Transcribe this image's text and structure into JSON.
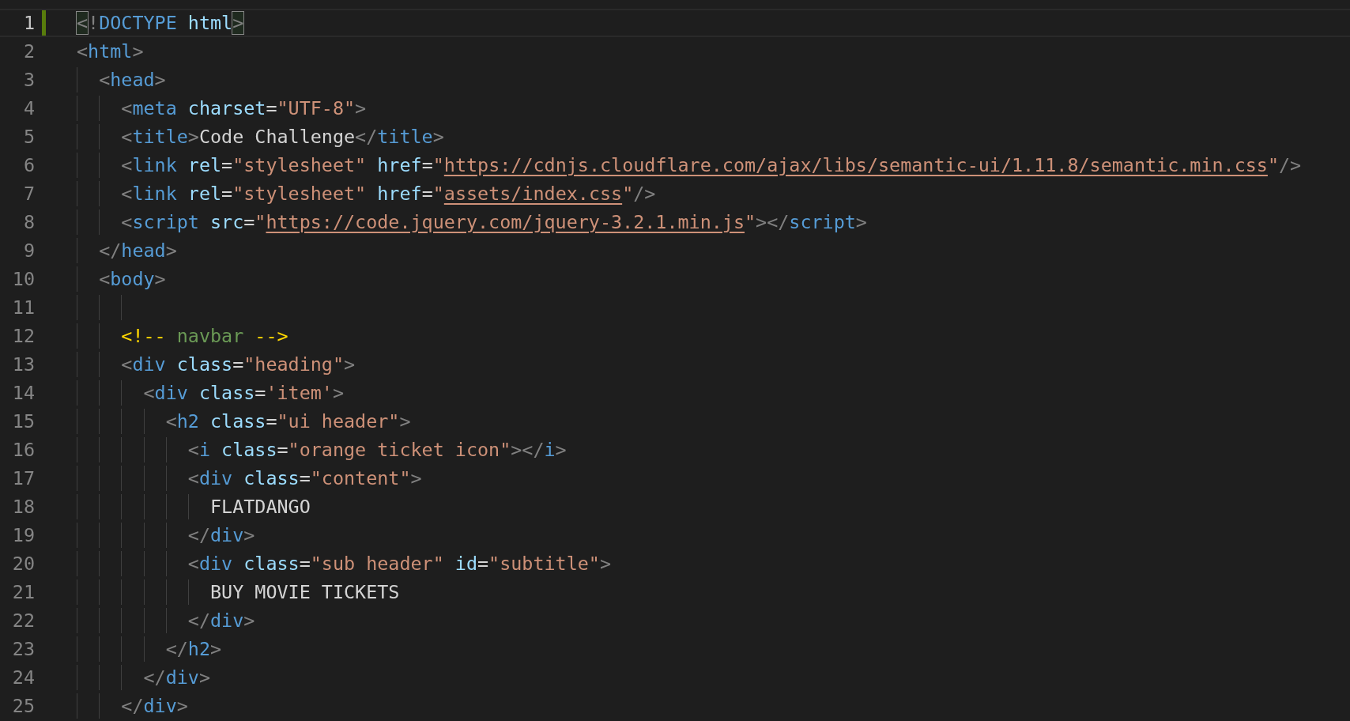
{
  "editor": {
    "lines": [
      {
        "number": "1",
        "current": true,
        "modified": true,
        "tokens": [
          {
            "kind": "match",
            "text": "<"
          },
          {
            "kind": "punct",
            "text": "!"
          },
          {
            "kind": "tag",
            "text": "DOCTYPE"
          },
          {
            "kind": "attr",
            "text": " html"
          },
          {
            "kind": "match",
            "text": ">"
          }
        ]
      },
      {
        "number": "2",
        "current": false,
        "modified": false,
        "tokens": [
          {
            "kind": "punct",
            "text": "<"
          },
          {
            "kind": "tag",
            "text": "html"
          },
          {
            "kind": "punct",
            "text": ">"
          }
        ]
      },
      {
        "number": "3",
        "current": false,
        "modified": false,
        "tokens": [
          {
            "kind": "punct",
            "text": "  <"
          },
          {
            "kind": "tag",
            "text": "head"
          },
          {
            "kind": "punct",
            "text": ">"
          }
        ]
      },
      {
        "number": "4",
        "current": false,
        "modified": false,
        "tokens": [
          {
            "kind": "punct",
            "text": "    <"
          },
          {
            "kind": "tag",
            "text": "meta"
          },
          {
            "kind": "attr",
            "text": " charset"
          },
          {
            "kind": "text",
            "text": "="
          },
          {
            "kind": "string",
            "text": "\"UTF-8\""
          },
          {
            "kind": "punct",
            "text": ">"
          }
        ]
      },
      {
        "number": "5",
        "current": false,
        "modified": false,
        "tokens": [
          {
            "kind": "punct",
            "text": "    <"
          },
          {
            "kind": "tag",
            "text": "title"
          },
          {
            "kind": "punct",
            "text": ">"
          },
          {
            "kind": "text",
            "text": "Code Challenge"
          },
          {
            "kind": "punct",
            "text": "</"
          },
          {
            "kind": "tag",
            "text": "title"
          },
          {
            "kind": "punct",
            "text": ">"
          }
        ]
      },
      {
        "number": "6",
        "current": false,
        "modified": false,
        "tokens": [
          {
            "kind": "punct",
            "text": "    <"
          },
          {
            "kind": "tag",
            "text": "link"
          },
          {
            "kind": "attr",
            "text": " rel"
          },
          {
            "kind": "text",
            "text": "="
          },
          {
            "kind": "string",
            "text": "\"stylesheet\""
          },
          {
            "kind": "attr",
            "text": " href"
          },
          {
            "kind": "text",
            "text": "="
          },
          {
            "kind": "string",
            "text": "\""
          },
          {
            "kind": "link",
            "text": "https://cdnjs.cloudflare.com/ajax/libs/semantic-ui/1.11.8/semantic.min.css"
          },
          {
            "kind": "string",
            "text": "\""
          },
          {
            "kind": "punct",
            "text": "/>"
          }
        ]
      },
      {
        "number": "7",
        "current": false,
        "modified": false,
        "tokens": [
          {
            "kind": "punct",
            "text": "    <"
          },
          {
            "kind": "tag",
            "text": "link"
          },
          {
            "kind": "attr",
            "text": " rel"
          },
          {
            "kind": "text",
            "text": "="
          },
          {
            "kind": "string",
            "text": "\"stylesheet\""
          },
          {
            "kind": "attr",
            "text": " href"
          },
          {
            "kind": "text",
            "text": "="
          },
          {
            "kind": "string",
            "text": "\""
          },
          {
            "kind": "link",
            "text": "assets/index.css"
          },
          {
            "kind": "string",
            "text": "\""
          },
          {
            "kind": "punct",
            "text": "/>"
          }
        ]
      },
      {
        "number": "8",
        "current": false,
        "modified": false,
        "tokens": [
          {
            "kind": "punct",
            "text": "    <"
          },
          {
            "kind": "tag",
            "text": "script"
          },
          {
            "kind": "attr",
            "text": " src"
          },
          {
            "kind": "text",
            "text": "="
          },
          {
            "kind": "string",
            "text": "\""
          },
          {
            "kind": "link",
            "text": "https://code.jquery.com/jquery-3.2.1.min.js"
          },
          {
            "kind": "string",
            "text": "\""
          },
          {
            "kind": "punct",
            "text": "></"
          },
          {
            "kind": "tag",
            "text": "script"
          },
          {
            "kind": "punct",
            "text": ">"
          }
        ]
      },
      {
        "number": "9",
        "current": false,
        "modified": false,
        "tokens": [
          {
            "kind": "punct",
            "text": "  </"
          },
          {
            "kind": "tag",
            "text": "head"
          },
          {
            "kind": "punct",
            "text": ">"
          }
        ]
      },
      {
        "number": "10",
        "current": false,
        "modified": false,
        "tokens": [
          {
            "kind": "punct",
            "text": "  <"
          },
          {
            "kind": "tag",
            "text": "body"
          },
          {
            "kind": "punct",
            "text": ">"
          }
        ]
      },
      {
        "number": "11",
        "current": false,
        "modified": false
      },
      {
        "number": "12",
        "current": false,
        "modified": false,
        "tokens": [
          {
            "kind": "comment-mark",
            "text": "    <!--"
          },
          {
            "kind": "comment",
            "text": " navbar "
          },
          {
            "kind": "comment-mark",
            "text": "-->"
          }
        ]
      },
      {
        "number": "13",
        "current": false,
        "modified": false,
        "tokens": [
          {
            "kind": "punct",
            "text": "    <"
          },
          {
            "kind": "tag",
            "text": "div"
          },
          {
            "kind": "attr",
            "text": " class"
          },
          {
            "kind": "text",
            "text": "="
          },
          {
            "kind": "string",
            "text": "\"heading\""
          },
          {
            "kind": "punct",
            "text": ">"
          }
        ]
      },
      {
        "number": "14",
        "current": false,
        "modified": false,
        "tokens": [
          {
            "kind": "punct",
            "text": "      <"
          },
          {
            "kind": "tag",
            "text": "div"
          },
          {
            "kind": "attr",
            "text": " class"
          },
          {
            "kind": "text",
            "text": "="
          },
          {
            "kind": "string",
            "text": "'item'"
          },
          {
            "kind": "punct",
            "text": ">"
          }
        ]
      },
      {
        "number": "15",
        "current": false,
        "modified": false,
        "tokens": [
          {
            "kind": "punct",
            "text": "        <"
          },
          {
            "kind": "tag",
            "text": "h2"
          },
          {
            "kind": "attr",
            "text": " class"
          },
          {
            "kind": "text",
            "text": "="
          },
          {
            "kind": "string",
            "text": "\"ui header\""
          },
          {
            "kind": "punct",
            "text": ">"
          }
        ]
      },
      {
        "number": "16",
        "current": false,
        "modified": false,
        "tokens": [
          {
            "kind": "punct",
            "text": "          <"
          },
          {
            "kind": "tag",
            "text": "i"
          },
          {
            "kind": "attr",
            "text": " class"
          },
          {
            "kind": "text",
            "text": "="
          },
          {
            "kind": "string",
            "text": "\"orange ticket icon\""
          },
          {
            "kind": "punct",
            "text": "></"
          },
          {
            "kind": "tag",
            "text": "i"
          },
          {
            "kind": "punct",
            "text": ">"
          }
        ]
      },
      {
        "number": "17",
        "current": false,
        "modified": false,
        "tokens": [
          {
            "kind": "punct",
            "text": "          <"
          },
          {
            "kind": "tag",
            "text": "div"
          },
          {
            "kind": "attr",
            "text": " class"
          },
          {
            "kind": "text",
            "text": "="
          },
          {
            "kind": "string",
            "text": "\"content\""
          },
          {
            "kind": "punct",
            "text": ">"
          }
        ]
      },
      {
        "number": "18",
        "current": false,
        "modified": false,
        "tokens": [
          {
            "kind": "text",
            "text": "            FLATDANGO"
          }
        ]
      },
      {
        "number": "19",
        "current": false,
        "modified": false,
        "tokens": [
          {
            "kind": "punct",
            "text": "          </"
          },
          {
            "kind": "tag",
            "text": "div"
          },
          {
            "kind": "punct",
            "text": ">"
          }
        ]
      },
      {
        "number": "20",
        "current": false,
        "modified": false,
        "tokens": [
          {
            "kind": "punct",
            "text": "          <"
          },
          {
            "kind": "tag",
            "text": "div"
          },
          {
            "kind": "attr",
            "text": " class"
          },
          {
            "kind": "text",
            "text": "="
          },
          {
            "kind": "string",
            "text": "\"sub header\""
          },
          {
            "kind": "attr",
            "text": " id"
          },
          {
            "kind": "text",
            "text": "="
          },
          {
            "kind": "string",
            "text": "\"subtitle\""
          },
          {
            "kind": "punct",
            "text": ">"
          }
        ]
      },
      {
        "number": "21",
        "current": false,
        "modified": false,
        "tokens": [
          {
            "kind": "text",
            "text": "            BUY MOVIE TICKETS"
          }
        ]
      },
      {
        "number": "22",
        "current": false,
        "modified": false,
        "tokens": [
          {
            "kind": "punct",
            "text": "          </"
          },
          {
            "kind": "tag",
            "text": "div"
          },
          {
            "kind": "punct",
            "text": ">"
          }
        ]
      },
      {
        "number": "23",
        "current": false,
        "modified": false,
        "tokens": [
          {
            "kind": "punct",
            "text": "        </"
          },
          {
            "kind": "tag",
            "text": "h2"
          },
          {
            "kind": "punct",
            "text": ">"
          }
        ]
      },
      {
        "number": "24",
        "current": false,
        "modified": false,
        "tokens": [
          {
            "kind": "punct",
            "text": "      </"
          },
          {
            "kind": "tag",
            "text": "div"
          },
          {
            "kind": "punct",
            "text": ">"
          }
        ]
      },
      {
        "number": "25",
        "current": false,
        "modified": false,
        "tokens": [
          {
            "kind": "punct",
            "text": "    </"
          },
          {
            "kind": "tag",
            "text": "div"
          },
          {
            "kind": "punct",
            "text": ">"
          }
        ]
      }
    ]
  }
}
